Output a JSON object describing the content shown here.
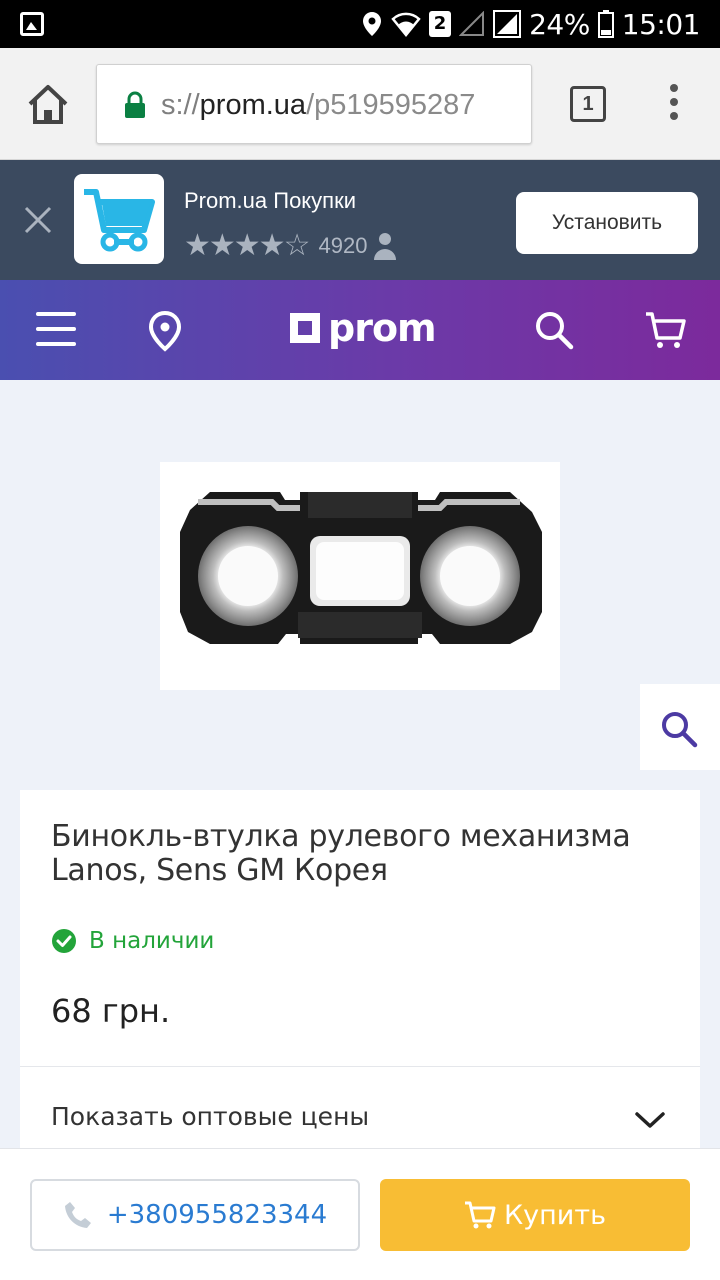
{
  "status_bar": {
    "signal_box": "2",
    "battery": "24%",
    "time": "15:01"
  },
  "browser": {
    "url_scheme": "s://",
    "url_host": "prom.ua",
    "url_path": "/p519595287",
    "tab_count": "1"
  },
  "app_banner": {
    "app_name": "Prom.ua Покупки",
    "rating_stars": "★★★★☆",
    "rating_count": "4920",
    "install_label": "Установить"
  },
  "site_header": {
    "logo_text": "prom"
  },
  "product": {
    "title": "Бинокль-втулка рулевого механизма Lanos, Sens GM Корея",
    "availability": "В наличии",
    "price": "68 грн.",
    "wholesale_label": "Показать оптовые цены"
  },
  "bottom_bar": {
    "phone": "+380955823344",
    "buy_label": "Купить"
  },
  "colors": {
    "header_gradient_start": "#4a4fb0",
    "header_gradient_end": "#7c2a9c",
    "banner_bg": "#3b4a5f",
    "in_stock_green": "#23a43a",
    "buy_button": "#f8bd34",
    "phone_link": "#2a7bd1",
    "page_bg": "#eef2f9"
  }
}
